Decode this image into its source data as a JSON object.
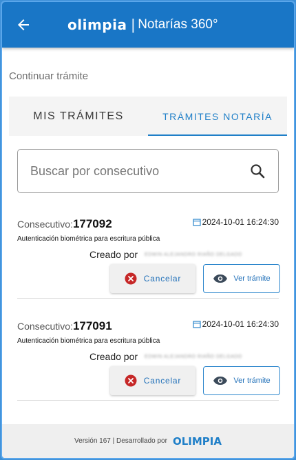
{
  "header": {
    "brand_logo": "OLIMPIA",
    "title": "Notarías 360°",
    "back_icon": "arrow-left-icon"
  },
  "section_label": "Continuar trámite",
  "tabs": [
    {
      "label": "MIS TRÁMITES",
      "active": false
    },
    {
      "label": "TRÁMITES NOTARÍA",
      "active": true
    }
  ],
  "search": {
    "placeholder": "Buscar por consecutivo",
    "value": ""
  },
  "cards": [
    {
      "consecutivo_label": "Consecutivo:",
      "consecutivo": "177092",
      "date": "2024-10-01 16:24:30",
      "description": "Autenticación biométrica para escritura pública",
      "created_label": "Creado por",
      "created_by": "EDWIN ALEJANDRO RIAÑO DELGADO",
      "cancel_label": "Cancelar",
      "view_label": "Ver trámite"
    },
    {
      "consecutivo_label": "Consecutivo:",
      "consecutivo": "177091",
      "date": "2024-10-01 16:24:30",
      "description": "Autenticación biométrica para escritura pública",
      "created_label": "Creado por",
      "created_by": "EDWIN ALEJANDRO RIAÑO DELGADO",
      "cancel_label": "Cancelar",
      "view_label": "Ver trámite"
    }
  ],
  "footer": {
    "text": "Versión 167 | Desarrollado por",
    "logo": "OLIMPIA"
  },
  "colors": {
    "primary": "#1976c6",
    "accent": "#1f7fc8",
    "cancel_icon": "#c62828"
  }
}
